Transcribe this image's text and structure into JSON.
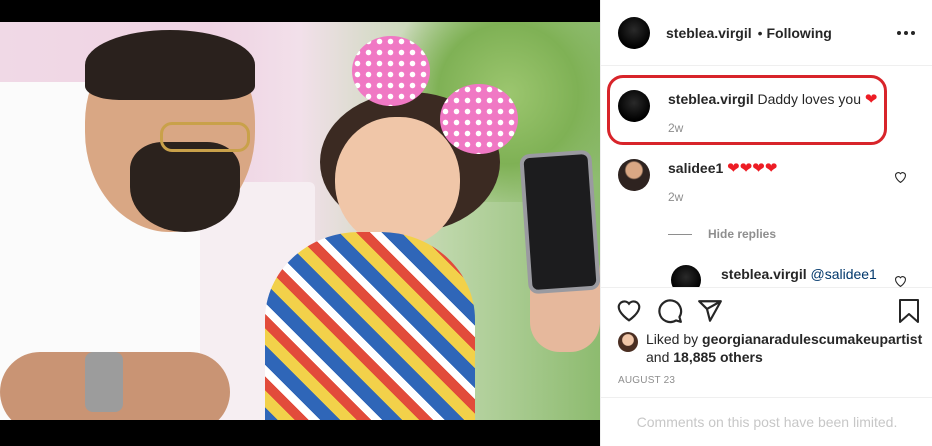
{
  "post": {
    "author": "steblea.virgil",
    "follow_status": "Following",
    "separator": "•",
    "more_icon": "more-horizontal-icon"
  },
  "comments": [
    {
      "username": "steblea.virgil",
      "text": "Daddy loves you",
      "emoji": "❤",
      "time": "2w",
      "highlighted": true
    },
    {
      "username": "salidee1",
      "text": "",
      "emoji": "❤❤❤❤",
      "time": "2w",
      "highlighted": false
    }
  ],
  "replies_toggle": "Hide replies",
  "reply": {
    "username": "steblea.virgil",
    "mention": "@salidee1"
  },
  "actions": {
    "like_icon": "heart-outline-icon",
    "comment_icon": "comment-icon",
    "share_icon": "paper-plane-icon",
    "save_icon": "bookmark-icon"
  },
  "likes": {
    "prefix": "Liked by",
    "user": "georgianaradulescumakeupartist",
    "middle": "and",
    "count": "18,885 others"
  },
  "date": "AUGUST 23",
  "comment_notice": "Comments on this post have been limited.",
  "colors": {
    "highlight": "#d8242a",
    "heart": "#ed1c24",
    "link": "#00376b"
  }
}
